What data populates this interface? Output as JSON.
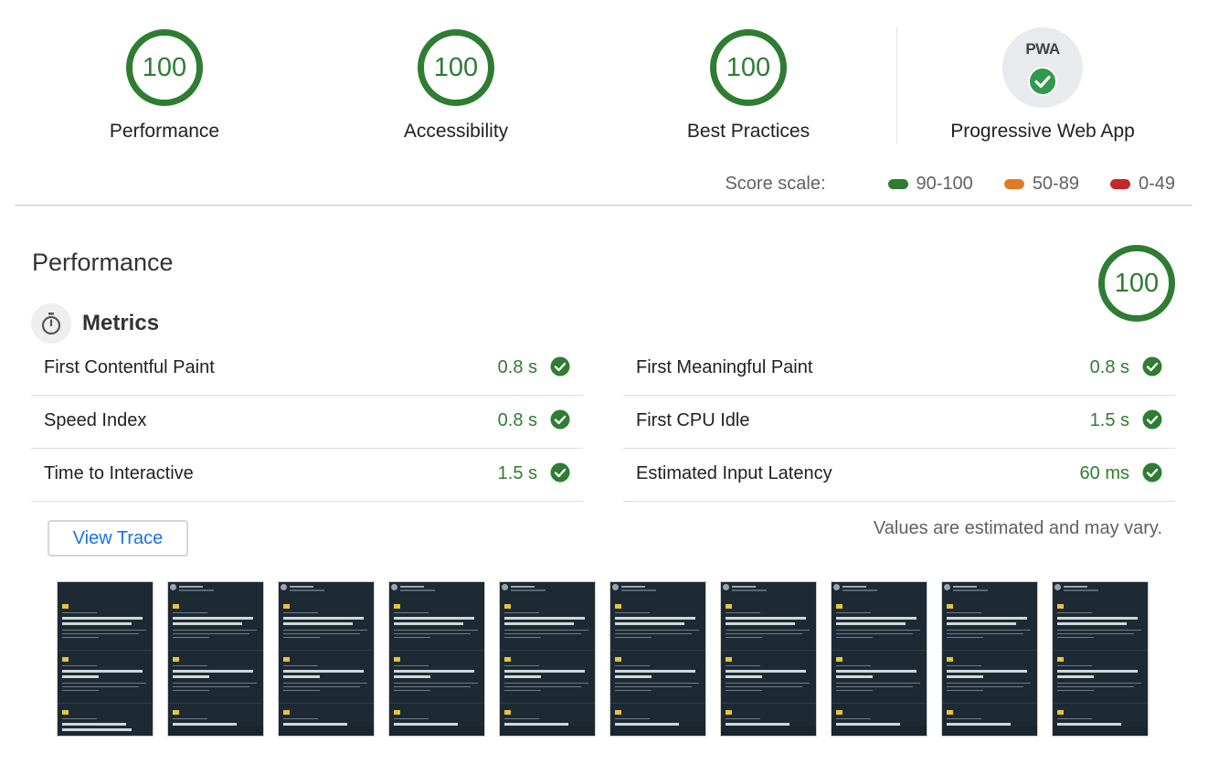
{
  "categories": [
    {
      "score": "100",
      "label": "Performance"
    },
    {
      "score": "100",
      "label": "Accessibility"
    },
    {
      "score": "100",
      "label": "Best Practices"
    }
  ],
  "pwa": {
    "badge": "PWA",
    "label": "Progressive Web App",
    "icon": "check-icon"
  },
  "scale": {
    "title": "Score scale:",
    "ranges": [
      {
        "label": "90-100",
        "color": "#2e7d32"
      },
      {
        "label": "50-89",
        "color": "#e07b25"
      },
      {
        "label": "0-49",
        "color": "#c62828"
      }
    ]
  },
  "performance": {
    "title": "Performance",
    "score": "100",
    "metrics_title": "Metrics",
    "metrics_icon": "stopwatch-icon",
    "metrics": [
      {
        "name": "First Contentful Paint",
        "value": "0.8 s"
      },
      {
        "name": "First Meaningful Paint",
        "value": "0.8 s"
      },
      {
        "name": "Speed Index",
        "value": "0.8 s"
      },
      {
        "name": "First CPU Idle",
        "value": "1.5 s"
      },
      {
        "name": "Time to Interactive",
        "value": "1.5 s"
      },
      {
        "name": "Estimated Input Latency",
        "value": "60 ms"
      }
    ],
    "view_trace": "View Trace",
    "note": "Values are estimated and may vary."
  },
  "colors": {
    "pass": "#2e7d32",
    "link": "#1a73e8"
  }
}
